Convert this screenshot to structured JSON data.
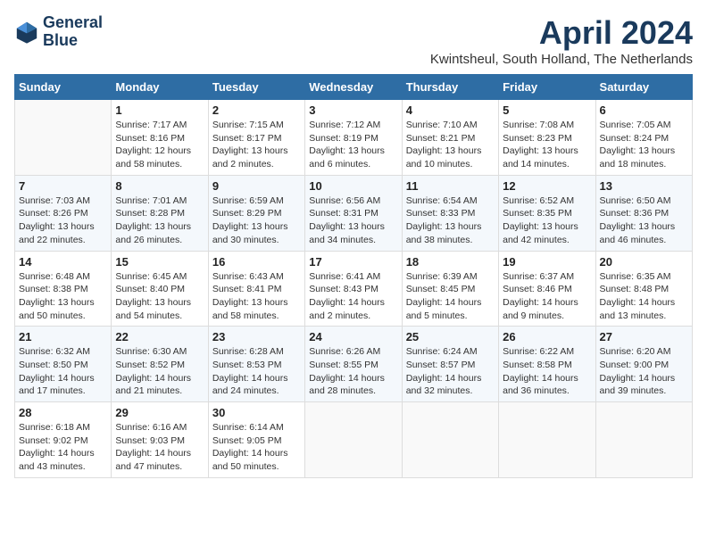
{
  "logo": {
    "line1": "General",
    "line2": "Blue"
  },
  "title": "April 2024",
  "subtitle": "Kwintsheul, South Holland, The Netherlands",
  "headers": [
    "Sunday",
    "Monday",
    "Tuesday",
    "Wednesday",
    "Thursday",
    "Friday",
    "Saturday"
  ],
  "weeks": [
    [
      {
        "day": "",
        "info": ""
      },
      {
        "day": "1",
        "info": "Sunrise: 7:17 AM\nSunset: 8:16 PM\nDaylight: 12 hours\nand 58 minutes."
      },
      {
        "day": "2",
        "info": "Sunrise: 7:15 AM\nSunset: 8:17 PM\nDaylight: 13 hours\nand 2 minutes."
      },
      {
        "day": "3",
        "info": "Sunrise: 7:12 AM\nSunset: 8:19 PM\nDaylight: 13 hours\nand 6 minutes."
      },
      {
        "day": "4",
        "info": "Sunrise: 7:10 AM\nSunset: 8:21 PM\nDaylight: 13 hours\nand 10 minutes."
      },
      {
        "day": "5",
        "info": "Sunrise: 7:08 AM\nSunset: 8:23 PM\nDaylight: 13 hours\nand 14 minutes."
      },
      {
        "day": "6",
        "info": "Sunrise: 7:05 AM\nSunset: 8:24 PM\nDaylight: 13 hours\nand 18 minutes."
      }
    ],
    [
      {
        "day": "7",
        "info": "Sunrise: 7:03 AM\nSunset: 8:26 PM\nDaylight: 13 hours\nand 22 minutes."
      },
      {
        "day": "8",
        "info": "Sunrise: 7:01 AM\nSunset: 8:28 PM\nDaylight: 13 hours\nand 26 minutes."
      },
      {
        "day": "9",
        "info": "Sunrise: 6:59 AM\nSunset: 8:29 PM\nDaylight: 13 hours\nand 30 minutes."
      },
      {
        "day": "10",
        "info": "Sunrise: 6:56 AM\nSunset: 8:31 PM\nDaylight: 13 hours\nand 34 minutes."
      },
      {
        "day": "11",
        "info": "Sunrise: 6:54 AM\nSunset: 8:33 PM\nDaylight: 13 hours\nand 38 minutes."
      },
      {
        "day": "12",
        "info": "Sunrise: 6:52 AM\nSunset: 8:35 PM\nDaylight: 13 hours\nand 42 minutes."
      },
      {
        "day": "13",
        "info": "Sunrise: 6:50 AM\nSunset: 8:36 PM\nDaylight: 13 hours\nand 46 minutes."
      }
    ],
    [
      {
        "day": "14",
        "info": "Sunrise: 6:48 AM\nSunset: 8:38 PM\nDaylight: 13 hours\nand 50 minutes."
      },
      {
        "day": "15",
        "info": "Sunrise: 6:45 AM\nSunset: 8:40 PM\nDaylight: 13 hours\nand 54 minutes."
      },
      {
        "day": "16",
        "info": "Sunrise: 6:43 AM\nSunset: 8:41 PM\nDaylight: 13 hours\nand 58 minutes."
      },
      {
        "day": "17",
        "info": "Sunrise: 6:41 AM\nSunset: 8:43 PM\nDaylight: 14 hours\nand 2 minutes."
      },
      {
        "day": "18",
        "info": "Sunrise: 6:39 AM\nSunset: 8:45 PM\nDaylight: 14 hours\nand 5 minutes."
      },
      {
        "day": "19",
        "info": "Sunrise: 6:37 AM\nSunset: 8:46 PM\nDaylight: 14 hours\nand 9 minutes."
      },
      {
        "day": "20",
        "info": "Sunrise: 6:35 AM\nSunset: 8:48 PM\nDaylight: 14 hours\nand 13 minutes."
      }
    ],
    [
      {
        "day": "21",
        "info": "Sunrise: 6:32 AM\nSunset: 8:50 PM\nDaylight: 14 hours\nand 17 minutes."
      },
      {
        "day": "22",
        "info": "Sunrise: 6:30 AM\nSunset: 8:52 PM\nDaylight: 14 hours\nand 21 minutes."
      },
      {
        "day": "23",
        "info": "Sunrise: 6:28 AM\nSunset: 8:53 PM\nDaylight: 14 hours\nand 24 minutes."
      },
      {
        "day": "24",
        "info": "Sunrise: 6:26 AM\nSunset: 8:55 PM\nDaylight: 14 hours\nand 28 minutes."
      },
      {
        "day": "25",
        "info": "Sunrise: 6:24 AM\nSunset: 8:57 PM\nDaylight: 14 hours\nand 32 minutes."
      },
      {
        "day": "26",
        "info": "Sunrise: 6:22 AM\nSunset: 8:58 PM\nDaylight: 14 hours\nand 36 minutes."
      },
      {
        "day": "27",
        "info": "Sunrise: 6:20 AM\nSunset: 9:00 PM\nDaylight: 14 hours\nand 39 minutes."
      }
    ],
    [
      {
        "day": "28",
        "info": "Sunrise: 6:18 AM\nSunset: 9:02 PM\nDaylight: 14 hours\nand 43 minutes."
      },
      {
        "day": "29",
        "info": "Sunrise: 6:16 AM\nSunset: 9:03 PM\nDaylight: 14 hours\nand 47 minutes."
      },
      {
        "day": "30",
        "info": "Sunrise: 6:14 AM\nSunset: 9:05 PM\nDaylight: 14 hours\nand 50 minutes."
      },
      {
        "day": "",
        "info": ""
      },
      {
        "day": "",
        "info": ""
      },
      {
        "day": "",
        "info": ""
      },
      {
        "day": "",
        "info": ""
      }
    ]
  ]
}
